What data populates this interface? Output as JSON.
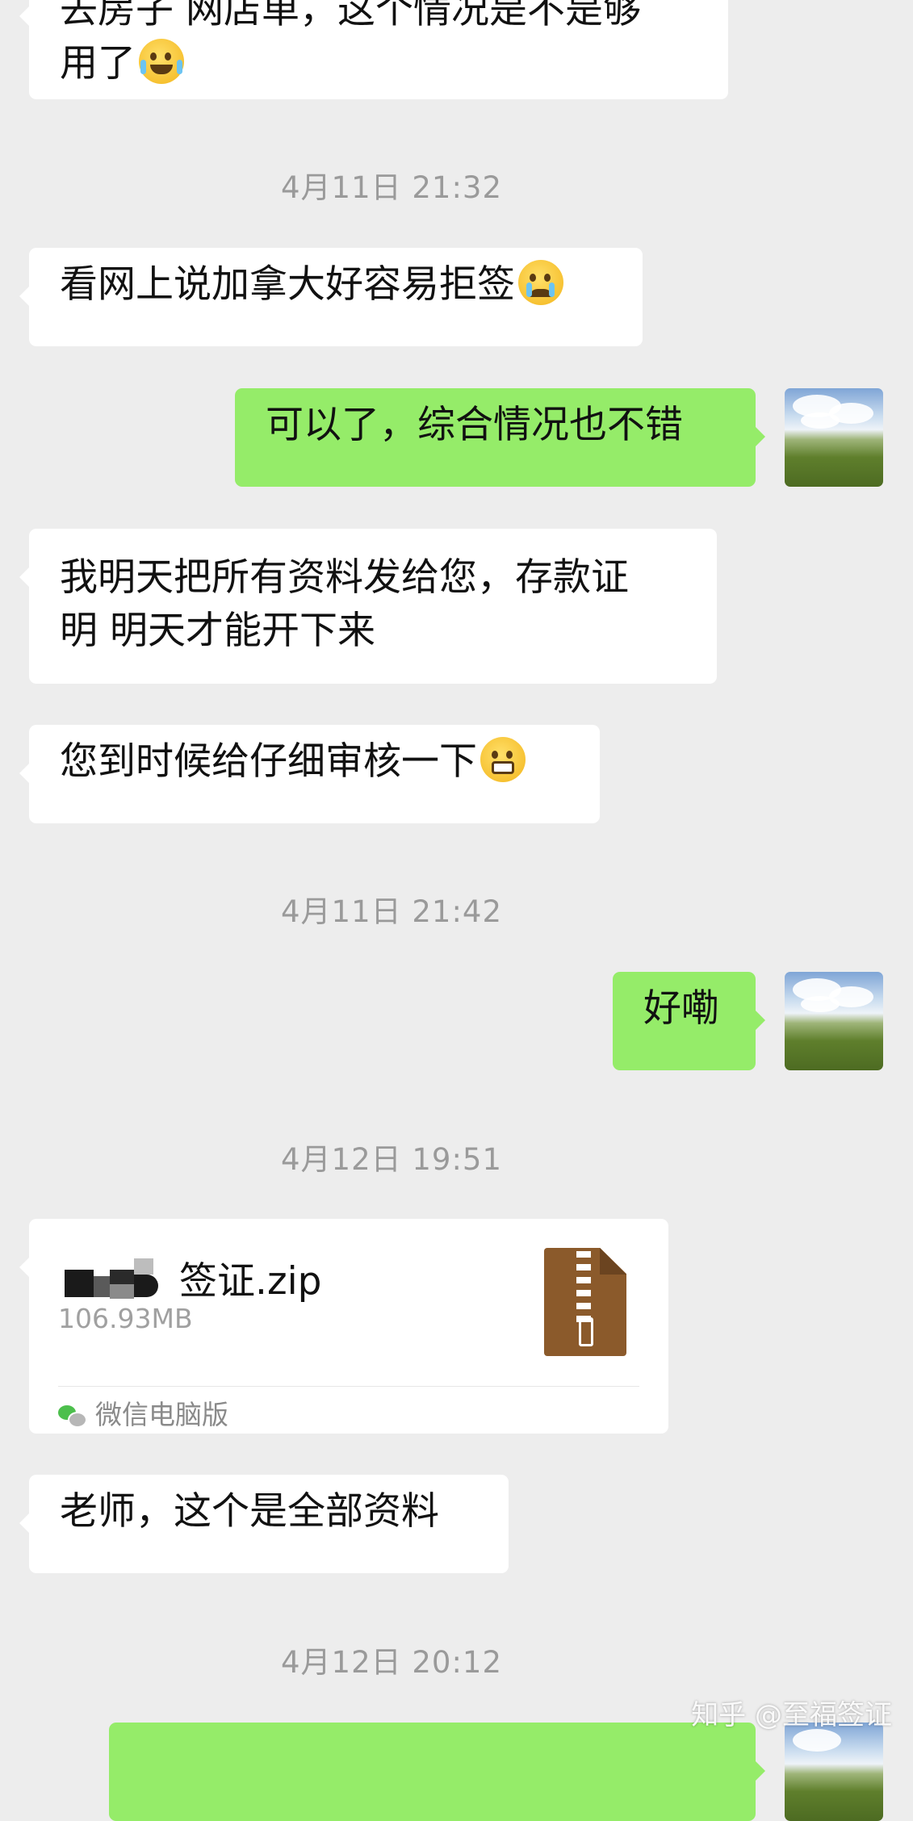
{
  "messages": {
    "m0": {
      "line1": "去房子 网店单，这个情况是不是够",
      "line2": "用了"
    },
    "t1": "4月11日 21:32",
    "m1": "看网上说加拿大好容易拒签",
    "m2": "可以了，综合情况也不错",
    "m3": {
      "line1": "我明天把所有资料发给您，存款证",
      "line2": "明 明天才能开下来"
    },
    "m4": "您到时候给仔细审核一下",
    "t2": "4月11日 21:42",
    "m5": "好嘞",
    "t3": "4月12日 19:51",
    "file": {
      "name": "签证.zip",
      "size": "106.93MB",
      "source": "微信电脑版"
    },
    "m6": "老师，这个是全部资料",
    "t4": "4月12日 20:12"
  },
  "icons": {
    "laugh_emoji": "laughing-tears-emoji",
    "cry_emoji": "crying-face-emoji",
    "grin_emoji": "grinning-face-emoji",
    "zip_icon": "zip-file-icon",
    "wechat_icon": "wechat-icon",
    "avatar": "landscape-avatar"
  },
  "watermark": "知乎 @至福签证",
  "colors": {
    "background": "#ededed",
    "incoming": "#ffffff",
    "outgoing": "#95ec69",
    "timestamp": "#9a9a9a"
  }
}
